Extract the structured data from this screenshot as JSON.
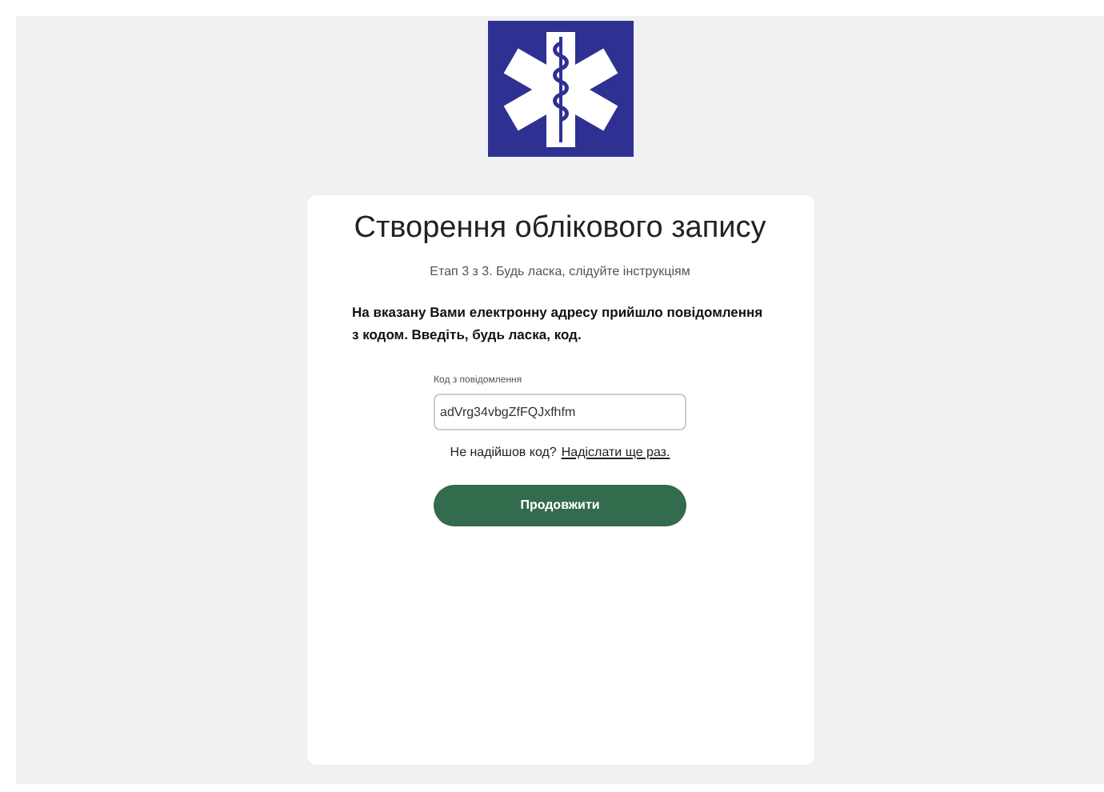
{
  "title": "Створення облікового запису",
  "step": "Етап 3 з 3. Будь ласка, слідуйте інструкціям",
  "message": "На вказану Вами електронну адресу прийшло повідомлення з кодом. Введіть, будь ласка, код.",
  "code_field": {
    "label": "Код з повідомлення",
    "value": "adVrg34vbgZfFQJxfhfm"
  },
  "resend": {
    "text": "Не надійшов код?",
    "link": "Надіслати ще раз."
  },
  "buttons": [
    "Продовжити"
  ]
}
